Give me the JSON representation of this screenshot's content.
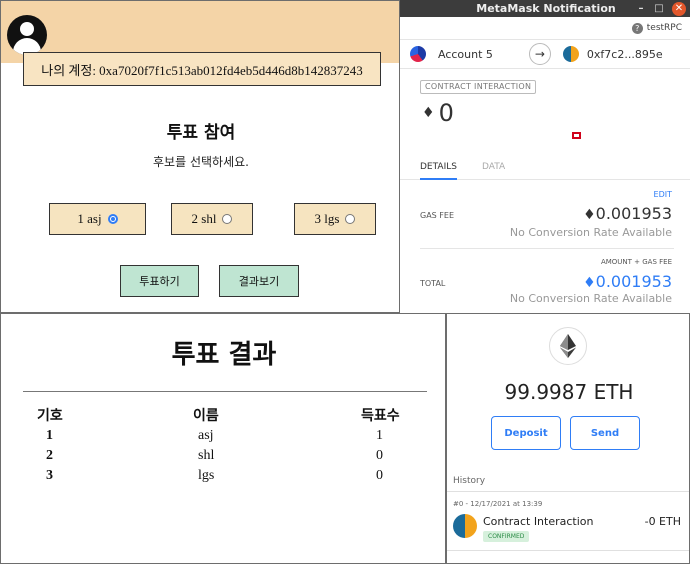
{
  "vote_app": {
    "account_text": "나의 계정: 0xa7020f7f1c513ab012fd4eb5d446d8b142837243",
    "title": "투표 참여",
    "subtitle": "후보를 선택하세요.",
    "candidates": [
      {
        "label": "1 asj",
        "selected": true
      },
      {
        "label": "2 shl",
        "selected": false
      },
      {
        "label": "3 lgs",
        "selected": false
      }
    ],
    "vote_button": "투표하기",
    "results_button": "결과보기"
  },
  "metamask_popup": {
    "window_title": "MetaMask Notification",
    "window_controls": {
      "minimize": "–",
      "maximize": "□",
      "close": "✕"
    },
    "network": "testRPC",
    "from_account": "Account 5",
    "to_account": "0xf7c2...895e",
    "badge": "CONTRACT INTERACTION",
    "amount": "0",
    "tabs": [
      "DETAILS",
      "DATA"
    ],
    "edit": "EDIT",
    "gas_fee_label": "GAS FEE",
    "gas_fee_value": "0.001953",
    "gas_fee_conversion": "No Conversion Rate Available",
    "amount_gas_label": "AMOUNT + GAS FEE",
    "total_label": "TOTAL",
    "total_value": "0.001953",
    "total_conversion": "No Conversion Rate Available"
  },
  "results": {
    "title": "투표 결과",
    "headers": [
      "기호",
      "이름",
      "득표수"
    ],
    "rows": [
      [
        "1",
        "asj",
        "1"
      ],
      [
        "2",
        "shl",
        "0"
      ],
      [
        "3",
        "lgs",
        "0"
      ]
    ]
  },
  "wallet": {
    "balance": "99.9987 ETH",
    "deposit_button": "Deposit",
    "send_button": "Send",
    "history_label": "History",
    "tx": {
      "meta": "#0 - 12/17/2021 at 13:39",
      "title": "Contract Interaction",
      "status": "CONFIRMED",
      "amount": "-0 ETH"
    }
  },
  "colors": {
    "header_peach": "#f4d4a7",
    "button_mint": "#bfe5d2",
    "metamask_blue": "#2f7df6",
    "confirmed_green": "#2a8a45"
  },
  "icons": [
    "user-avatar-icon",
    "help-icon",
    "arrow-right-icon",
    "ethereum-icon",
    "account-identicon"
  ]
}
